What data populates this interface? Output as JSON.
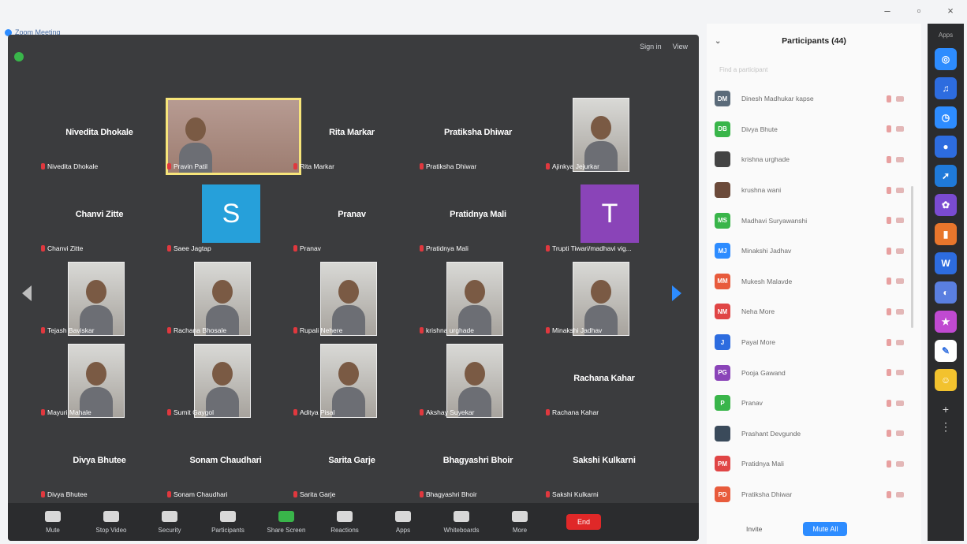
{
  "window": {
    "title": "Zoom Meeting",
    "controls": [
      "–",
      "▫",
      "×"
    ]
  },
  "meeting": {
    "top_right": [
      "Sign in",
      "View"
    ],
    "tiles": [
      {
        "display": "Nivedita Dhokale",
        "label": "Nivedita Dhokale",
        "kind": "name",
        "col": 0,
        "row": 0
      },
      {
        "display": "",
        "label": "Pravin Patil",
        "kind": "video-active",
        "col": 1,
        "row": 0
      },
      {
        "display": "Rita Markar",
        "label": "Rita Markar",
        "kind": "name",
        "col": 2,
        "row": 0
      },
      {
        "display": "Pratiksha Dhiwar",
        "label": "Pratiksha Dhiwar",
        "kind": "name",
        "col": 3,
        "row": 0
      },
      {
        "display": "",
        "label": "Ajinkya Jejurkar",
        "kind": "video",
        "col": 4,
        "row": 0
      },
      {
        "display": "Chanvi Zitte",
        "label": "Chanvi Zitte",
        "kind": "name",
        "col": 0,
        "row": 1
      },
      {
        "display": "S",
        "label": "Saee Jagtap",
        "kind": "avatar",
        "color": "#26a0da",
        "col": 1,
        "row": 1
      },
      {
        "display": "Pranav",
        "label": "Pranav",
        "kind": "name",
        "col": 2,
        "row": 1
      },
      {
        "display": "Pratidnya Mali",
        "label": "Pratidnya Mali",
        "kind": "name",
        "col": 3,
        "row": 1
      },
      {
        "display": "T",
        "label": "Trupti Tiwari/madhavi vig...",
        "kind": "avatar",
        "color": "#8a44b8",
        "col": 4,
        "row": 1
      },
      {
        "display": "",
        "label": "Tejash Baviskar",
        "kind": "video",
        "col": 0,
        "row": 2
      },
      {
        "display": "",
        "label": "Rachana Bhosale",
        "kind": "video",
        "col": 1,
        "row": 2
      },
      {
        "display": "",
        "label": "Rupali Nehere",
        "kind": "video",
        "col": 2,
        "row": 2
      },
      {
        "display": "",
        "label": "krishna urghade",
        "kind": "video",
        "col": 3,
        "row": 2
      },
      {
        "display": "",
        "label": "Minakshi Jadhav",
        "kind": "video",
        "col": 4,
        "row": 2
      },
      {
        "display": "",
        "label": "Mayuri Mahale",
        "kind": "video",
        "col": 0,
        "row": 3
      },
      {
        "display": "",
        "label": "Sumit Gaygol",
        "kind": "video",
        "col": 1,
        "row": 3
      },
      {
        "display": "",
        "label": "Aditya Pisal",
        "kind": "video",
        "col": 2,
        "row": 3
      },
      {
        "display": "",
        "label": "Akshay Suyekar",
        "kind": "video",
        "col": 3,
        "row": 3
      },
      {
        "display": "Rachana Kahar",
        "label": "Rachana Kahar",
        "kind": "name",
        "col": 4,
        "row": 3
      },
      {
        "display": "Divya Bhutee",
        "label": "Divya Bhutee",
        "kind": "name",
        "col": 0,
        "row": 4
      },
      {
        "display": "Sonam Chaudhari",
        "label": "Sonam Chaudhari",
        "kind": "name",
        "col": 1,
        "row": 4
      },
      {
        "display": "Sarita Garje",
        "label": "Sarita Garje",
        "kind": "name",
        "col": 2,
        "row": 4
      },
      {
        "display": "Bhagyashri Bhoir",
        "label": "Bhagyashri Bhoir",
        "kind": "name",
        "col": 3,
        "row": 4
      },
      {
        "display": "Sakshi Kulkarni",
        "label": "Sakshi Kulkarni",
        "kind": "name",
        "col": 4,
        "row": 4
      }
    ],
    "toolbar": [
      {
        "id": "mute",
        "label": "Mute"
      },
      {
        "id": "video",
        "label": "Stop Video"
      },
      {
        "id": "security",
        "label": "Security"
      },
      {
        "id": "participants",
        "label": "Participants"
      },
      {
        "id": "share",
        "label": "Share Screen"
      },
      {
        "id": "reactions",
        "label": "Reactions"
      },
      {
        "id": "apps",
        "label": "Apps"
      },
      {
        "id": "whiteboards",
        "label": "Whiteboards"
      },
      {
        "id": "more",
        "label": "More"
      }
    ],
    "end_label": "End"
  },
  "participants_panel": {
    "title": "Participants (44)",
    "search_placeholder": "Find a participant",
    "rows": [
      {
        "initials": "DM",
        "name": "Dinesh Madhukar kapse",
        "color": "#5b6b7a"
      },
      {
        "initials": "DB",
        "name": "Divya Bhute",
        "color": "#39b54a"
      },
      {
        "initials": "",
        "name": "krishna urghade",
        "color": "#444444"
      },
      {
        "initials": "",
        "name": "krushna wani",
        "color": "#6b4a3a"
      },
      {
        "initials": "MS",
        "name": "Madhavi Suryawanshi",
        "color": "#39b54a"
      },
      {
        "initials": "MJ",
        "name": "Minakshi Jadhav",
        "color": "#2d8cff"
      },
      {
        "initials": "MM",
        "name": "Mukesh Malavde",
        "color": "#e85b3c"
      },
      {
        "initials": "NM",
        "name": "Neha More",
        "color": "#e04545"
      },
      {
        "initials": "J",
        "name": "Payal More",
        "color": "#2d6cdf"
      },
      {
        "initials": "PG",
        "name": "Pooja Gawand",
        "color": "#8a44b8"
      },
      {
        "initials": "P",
        "name": "Pranav",
        "color": "#39b54a"
      },
      {
        "initials": "",
        "name": "Prashant Devgunde",
        "color": "#3a4a5a"
      },
      {
        "initials": "PM",
        "name": "Pratidnya Mali",
        "color": "#e04545"
      },
      {
        "initials": "PD",
        "name": "Pratiksha Dhiwar",
        "color": "#e85b3c"
      }
    ],
    "invite_label": "Invite",
    "mute_all_label": "Mute All"
  },
  "apps_rail": {
    "header": "Apps",
    "apps": [
      {
        "icon": "camera-app-icon",
        "glyph": "◎",
        "color": "#2d8cff"
      },
      {
        "icon": "music-app-icon",
        "glyph": "♫",
        "color": "#2d6cdf"
      },
      {
        "icon": "timer-app-icon",
        "glyph": "◷",
        "color": "#2d8cff"
      },
      {
        "icon": "user-app-icon",
        "glyph": "●",
        "color": "#2d6cdf"
      },
      {
        "icon": "rocket-app-icon",
        "glyph": "➚",
        "color": "#1f7ad9"
      },
      {
        "icon": "game-app-icon",
        "glyph": "✿",
        "color": "#7a4bd1"
      },
      {
        "icon": "book-app-icon",
        "glyph": "▮",
        "color": "#e8762c"
      },
      {
        "icon": "word-app-icon",
        "glyph": "W",
        "color": "#2d6cdf"
      },
      {
        "icon": "globe-app-icon",
        "glyph": "◐",
        "color": "#5a7fe0"
      },
      {
        "icon": "trivia-app-icon",
        "glyph": "★",
        "color": "#c04ad1"
      },
      {
        "icon": "notes-app-icon",
        "glyph": "✎",
        "color": "#ffffff"
      },
      {
        "icon": "smiley-app-icon",
        "glyph": "☺",
        "color": "#f2c22e"
      }
    ]
  }
}
